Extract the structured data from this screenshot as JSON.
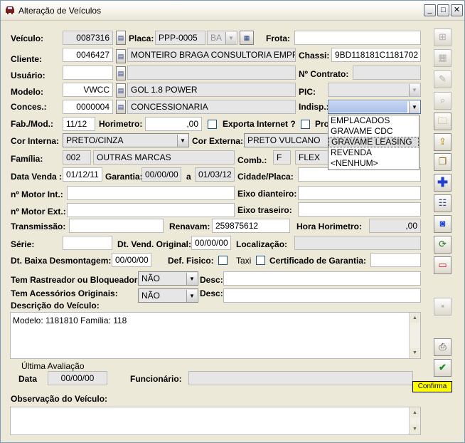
{
  "window": {
    "title": "Alteração de Veículos",
    "minimize_glyph": "_",
    "maximize_glyph": "□",
    "close_glyph": "✕"
  },
  "form": {
    "veiculo": {
      "label": "Veículo:",
      "value": "0087316"
    },
    "placa": {
      "label": "Placa:",
      "value": "PPP-0005",
      "uf": "BA"
    },
    "frota": {
      "label": "Frota:",
      "value": ""
    },
    "cliente": {
      "label": "Cliente:",
      "code": "0046427",
      "name": "MONTEIRO BRAGA CONSULTORIA EMPRI"
    },
    "chassi": {
      "label": "Chassi:",
      "value": "9BD118181C1181702"
    },
    "usuario": {
      "label": "Usuário:",
      "code": "",
      "name": ""
    },
    "contrato": {
      "label": "Nº Contrato:",
      "value": ""
    },
    "modelo": {
      "label": "Modelo:",
      "code": "VWCC",
      "name": "GOL 1.8 POWER"
    },
    "pic": {
      "label": "PIC:",
      "value": ""
    },
    "conces": {
      "label": "Conces.:",
      "code": "0000004",
      "name": "CONCESSIONARIA"
    },
    "indisp": {
      "label": "Indisp.:",
      "value": ""
    },
    "fabmod": {
      "label": "Fab./Mod.:",
      "value": "11/12"
    },
    "horimetro": {
      "label": "Horimetro:",
      "value": ",00"
    },
    "exporta": {
      "label": "Exporta Internet ?"
    },
    "pro": {
      "label": "Pro"
    },
    "cor_interna": {
      "label": "Cor Interna:",
      "value": "PRETO/CINZA"
    },
    "cor_externa": {
      "label": "Cor Externa:",
      "value": "PRETO VULCANO"
    },
    "familia": {
      "label": "Família:",
      "code": "002",
      "name": "OUTRAS MARCAS"
    },
    "comb": {
      "label": "Comb.:",
      "code": "F",
      "name": "FLEX"
    },
    "data_venda": {
      "label": "Data Venda :",
      "value": "01/12/11"
    },
    "garantia": {
      "label": "Garantia:",
      "from": "00/00/00",
      "sep": "a",
      "to": "01/03/12"
    },
    "cidade_placa": {
      "label": "Cidade/Placa:",
      "value": ""
    },
    "motor_int": {
      "label": "nº Motor Int.:",
      "value": ""
    },
    "eixo_dianteiro": {
      "label": "Eixo dianteiro:",
      "value": ""
    },
    "motor_ext": {
      "label": "nº Motor Ext.:",
      "value": ""
    },
    "eixo_traseiro": {
      "label": "Eixo traseiro:",
      "value": ""
    },
    "transmissao": {
      "label": "Transmissão:",
      "value": ""
    },
    "renavam": {
      "label": "Renavam:",
      "value": "259875612"
    },
    "hora_horimetro": {
      "label": "Hora Horimetro:",
      "value": ",00"
    },
    "serie": {
      "label": "Série:",
      "value": ""
    },
    "dt_vend_original": {
      "label": "Dt. Vend. Original:",
      "value": "00/00/00"
    },
    "localizacao": {
      "label": "Localização:",
      "value": ""
    },
    "dt_baixa": {
      "label": "Dt. Baixa Desmontagem:",
      "value": "00/00/00"
    },
    "def_fisico": {
      "label": "Def. Fisico:"
    },
    "taxi": {
      "label": "Taxi"
    },
    "certificado": {
      "label": "Certificado de Garantia:",
      "value": ""
    },
    "rastreador": {
      "label": "Tem Rastreador ou Bloqueador:",
      "value": "NÃO",
      "desc_label": "Desc:",
      "desc": ""
    },
    "acessorios": {
      "label": "Tem Acessórios Originais:",
      "value": "NÃO",
      "desc_label": "Desc:",
      "desc": ""
    },
    "descricao": {
      "label": "Descrição do Veículo:",
      "value": "Modelo: 1181810 Família: 118"
    },
    "ultima_avaliacao": {
      "label": "Última Avaliação",
      "data_label": "Data",
      "data": "00/00/00",
      "func_label": "Funcionário:",
      "func": ""
    },
    "observacao": {
      "label": "Observação do Veículo:",
      "value": ""
    }
  },
  "indisp_options": [
    "EMPLACADOS",
    "GRAVAME CDC",
    "GRAVAME LEASING",
    "REVENDA",
    "<NENHUM>"
  ],
  "indisp_highlighted": "GRAVAME LEASING",
  "toolbar": [
    "add-row-icon",
    "table-icon",
    "eraser-icon",
    "preview-icon",
    "open-folder-icon",
    "folder-up-icon",
    "copy-icon",
    "plus-icon",
    "people-icon",
    "camera-icon",
    "refresh-icon",
    "card-icon",
    "disabled-icon",
    "print-icon",
    "confirm-icon"
  ],
  "tooltip": "Confirma",
  "colors": {
    "accent": "#1f5fd0",
    "tooltip": "#ffff00",
    "highlight": "#dcdcdc"
  }
}
